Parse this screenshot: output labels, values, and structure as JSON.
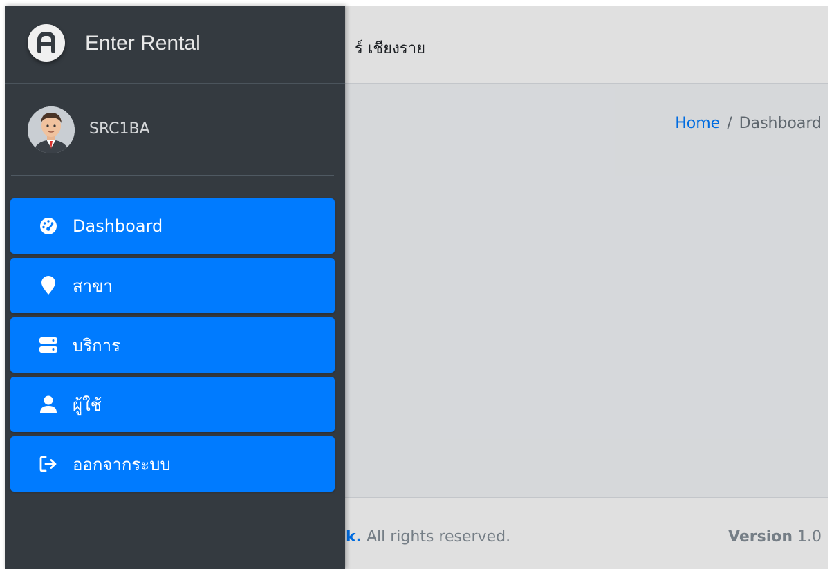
{
  "app": {
    "brand_name": "Enter Rental",
    "topbar_title_fragment": "ร์ เชียงราย"
  },
  "user": {
    "name": "SRC1BA"
  },
  "breadcrumb": {
    "home": "Home",
    "separator": "/",
    "current": "Dashboard"
  },
  "sidebar": {
    "items": [
      {
        "label": "Dashboard",
        "icon": "tachometer-icon"
      },
      {
        "label": "สาขา",
        "icon": "map-marker-icon"
      },
      {
        "label": "บริการ",
        "icon": "server-icon"
      },
      {
        "label": "ผู้ใช้",
        "icon": "user-icon"
      },
      {
        "label": "ออกจากระบบ",
        "icon": "sign-out-icon"
      }
    ]
  },
  "footer": {
    "copyright_fragment": "k.",
    "rights": " All rights reserved.",
    "version_label": "Version",
    "version_value": " 1.0"
  },
  "colors": {
    "sidebar_bg": "#343a40",
    "nav_active": "#007bff",
    "link": "#007bff"
  }
}
